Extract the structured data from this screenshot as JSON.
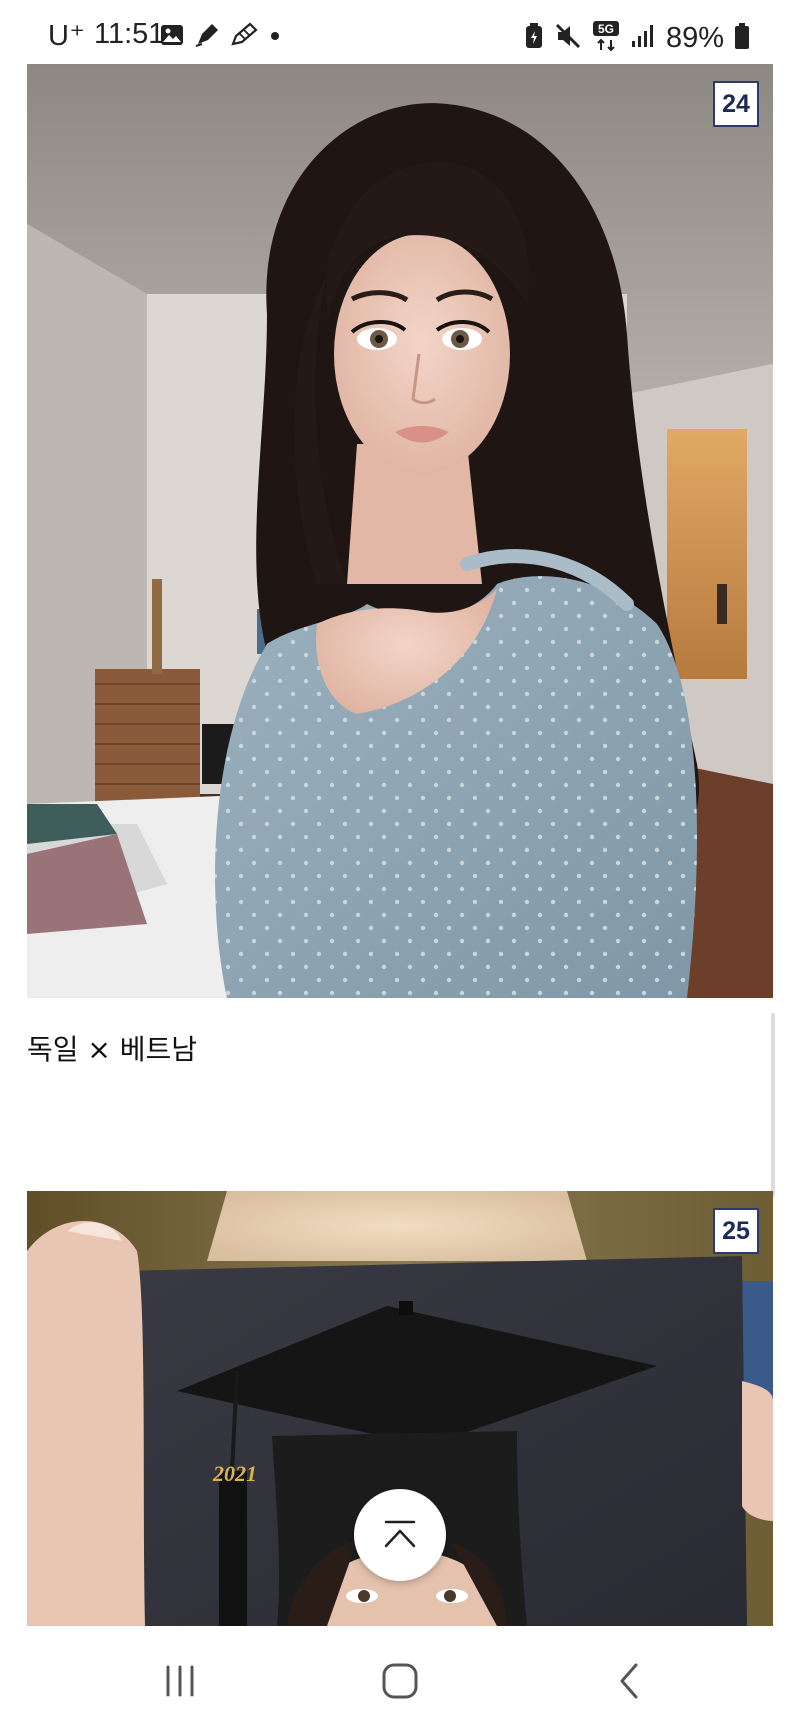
{
  "status_bar": {
    "carrier": "U⁺",
    "time": "11:51",
    "network": "5G",
    "battery": "89%",
    "left_icons": [
      "gallery-icon",
      "pen-icon",
      "pencil-icon",
      "dot-icon"
    ],
    "right_icons": [
      "battery-saver-icon",
      "mute-icon",
      "5g-icon",
      "signal-icon",
      "battery-icon"
    ]
  },
  "cards": [
    {
      "rank": "24",
      "caption": "독일 × 베트남",
      "image": "portrait-photo"
    },
    {
      "rank": "25",
      "image": "graduation-photo",
      "photo_text": "2021"
    }
  ],
  "scroll_top": {
    "icon": "chevron-up-bar-icon"
  },
  "nav_bar": {
    "icons": [
      "recents-icon",
      "home-icon",
      "back-icon"
    ]
  },
  "colors": {
    "badge_border": "#2b3b6b",
    "badge_text": "#1e2b57"
  }
}
